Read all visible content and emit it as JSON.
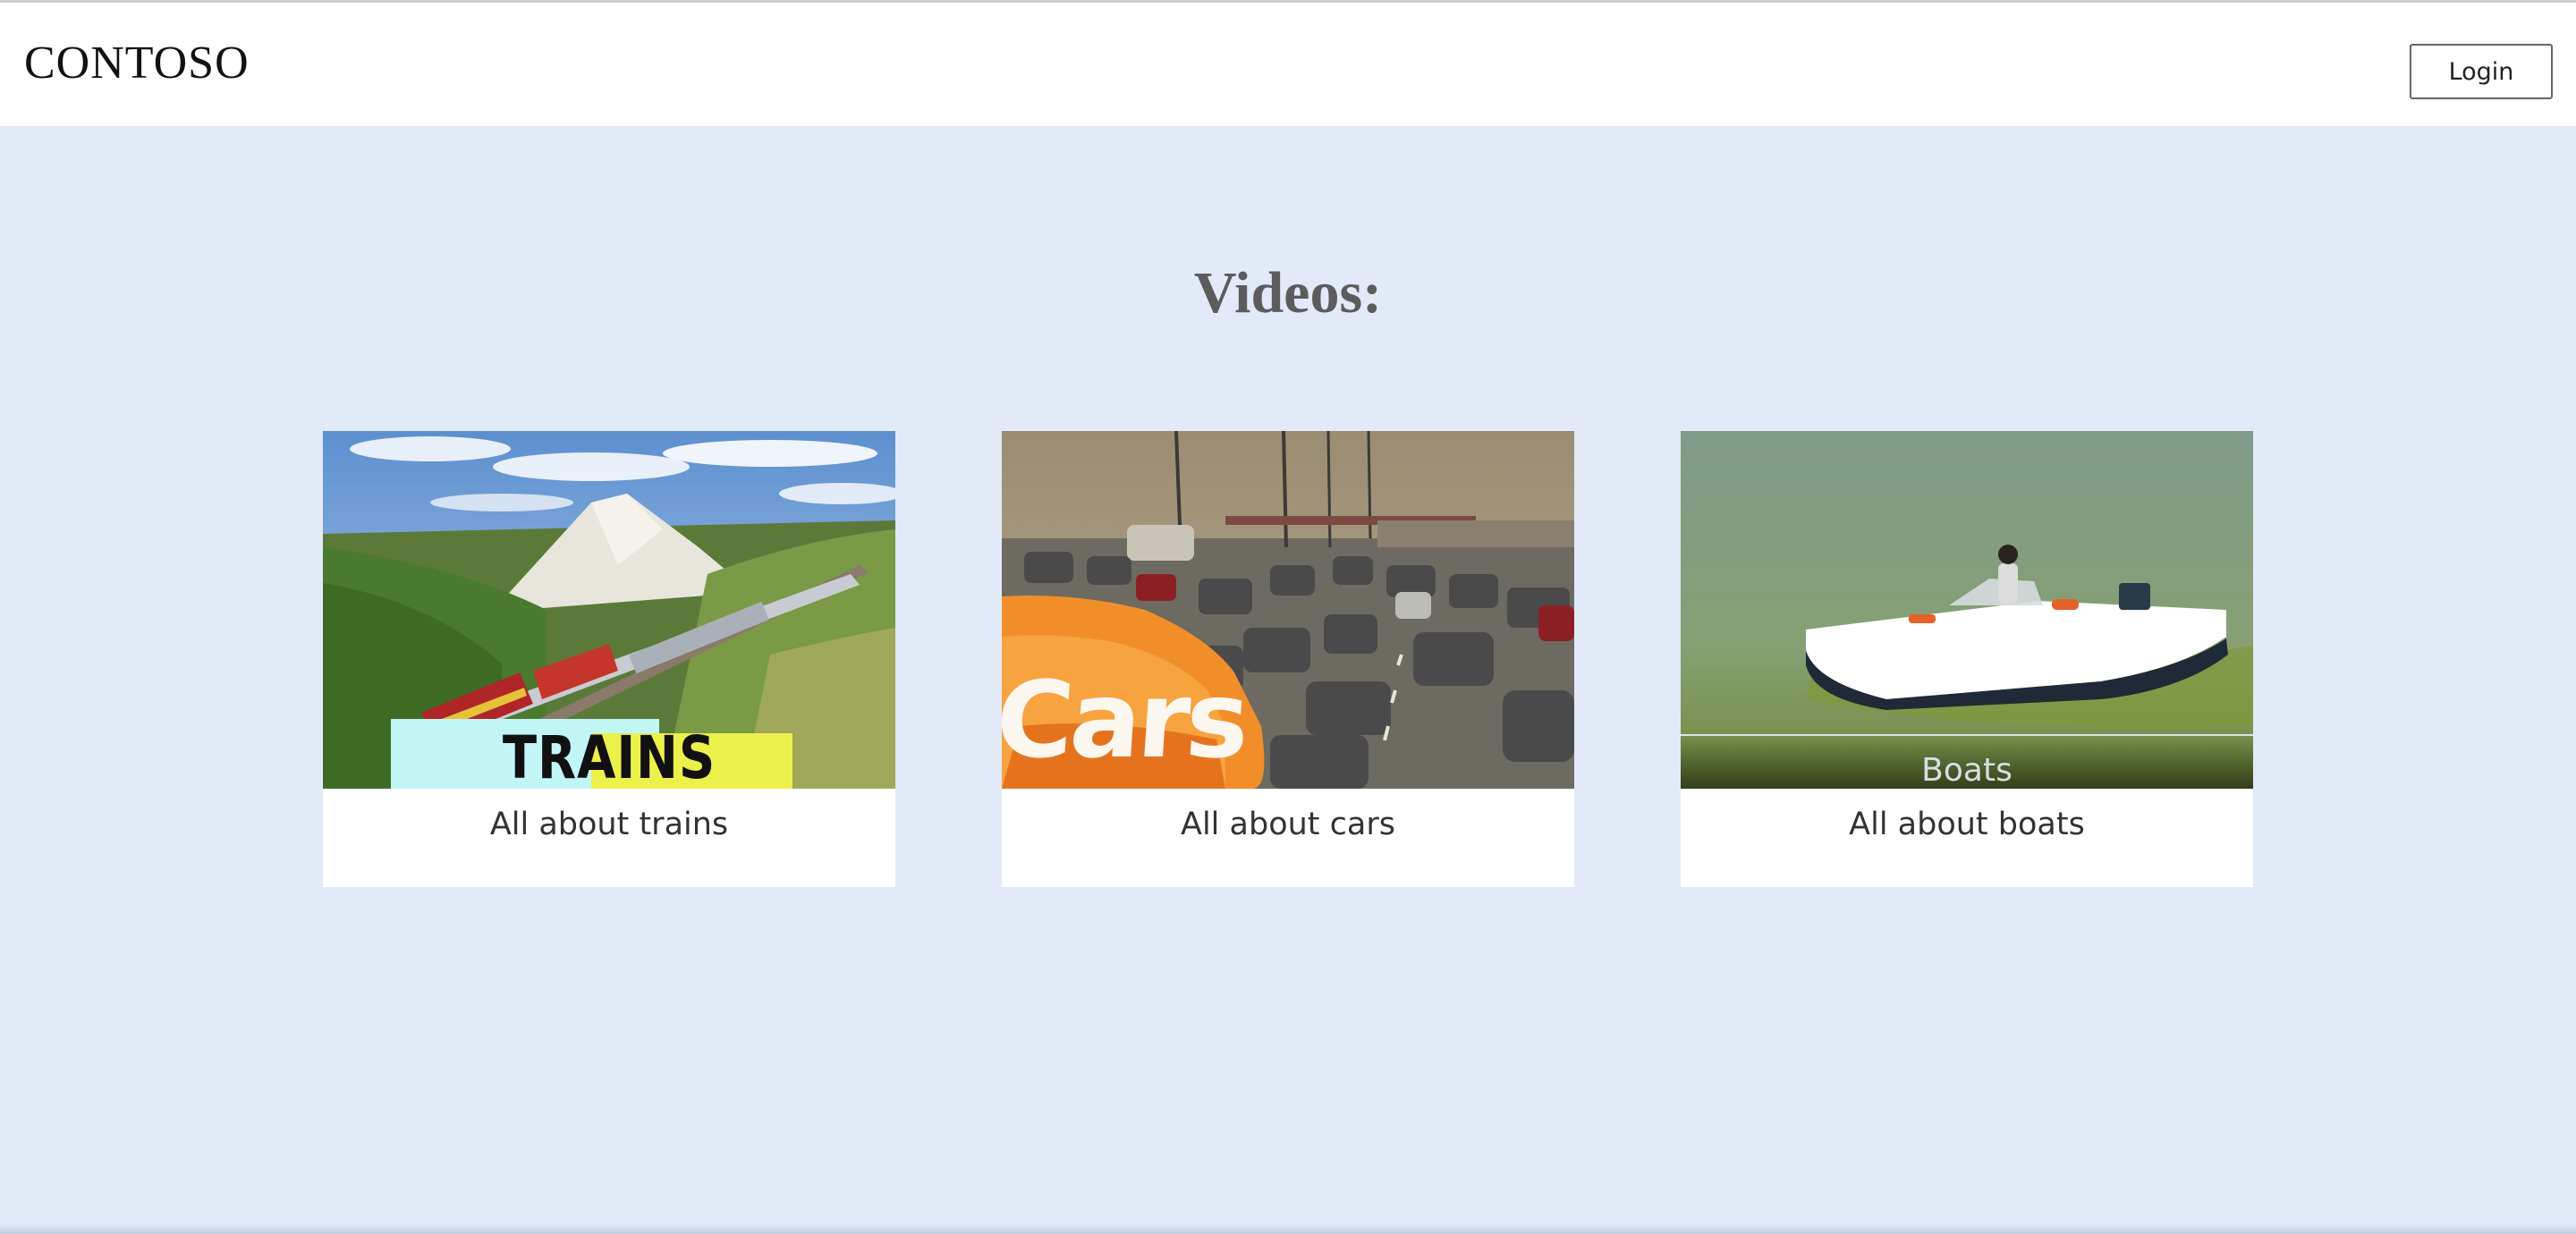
{
  "header": {
    "brand": "CONTOSO",
    "login_label": "Login"
  },
  "main": {
    "title": "Videos:",
    "videos": [
      {
        "thumb_text": "TRAINS",
        "caption": "All about trains"
      },
      {
        "thumb_text": "Cars",
        "caption": "All about cars"
      },
      {
        "thumb_text": "Boats",
        "caption": "All about boats"
      }
    ]
  },
  "colors": {
    "page_background": "#e1eaf6",
    "header_background": "#ffffff",
    "card_background": "#ffffff",
    "title_text": "#5c5c5c"
  }
}
